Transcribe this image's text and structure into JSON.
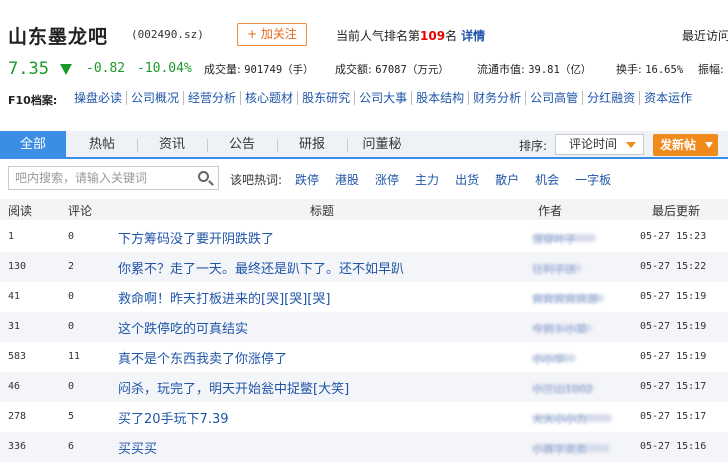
{
  "bar": {
    "name": "山东墨龙吧",
    "code": "(002490.sz)",
    "follow_label": "+ 加关注",
    "rank_prefix": "当前人气排名第",
    "rank_value": "109",
    "rank_suffix": "名",
    "rank_detail": "详情",
    "recent_visit": "最近访问"
  },
  "quote": {
    "price": "7.35",
    "change": "-0.82",
    "change_pct": "-10.04%",
    "direction": "down",
    "color": "#1a9a2a",
    "stats": [
      {
        "label": "成交量:",
        "value": "901749（手）"
      },
      {
        "label": "成交额:",
        "value": "67087（万元）"
      },
      {
        "label": "流通市值:",
        "value": "39.81（亿）"
      },
      {
        "label": "换手:",
        "value": "16.65%"
      },
      {
        "label": "振幅:",
        "value": ""
      }
    ]
  },
  "f10": {
    "label": "F10档案:",
    "links": [
      "操盘必读",
      "公司概况",
      "经营分析",
      "核心题材",
      "股东研究",
      "公司大事",
      "股本结构",
      "财务分析",
      "公司高管",
      "分红融资",
      "资本运作"
    ]
  },
  "tabs": {
    "items": [
      "全部",
      "热帖",
      "资讯",
      "公告",
      "研报",
      "问董秘"
    ],
    "active": 0,
    "sort_label": "排序:",
    "sort_value": "评论时间",
    "post_button": "发新帖"
  },
  "search": {
    "placeholder": "吧内搜索，请输入关键词",
    "hot_label": "该吧热词:",
    "hot_words": [
      "跌停",
      "港股",
      "涨停",
      "主力",
      "出货",
      "散户",
      "机会",
      "一字板"
    ]
  },
  "table": {
    "headers": {
      "read": "阅读",
      "comment": "评论",
      "title": "标题",
      "author": "作者",
      "updated": "最后更新"
    },
    "rows": [
      {
        "read": "1",
        "comment": "0",
        "title": "下方筹码没了要开阴跌跌了",
        "author": "涅穿叶子",
        "time": "05-27 15:23"
      },
      {
        "read": "130",
        "comment": "2",
        "title": "你累不？走了一天。最终还是趴下了。还不如早趴",
        "author": "让利子送",
        "time": "05-27 15:22"
      },
      {
        "read": "41",
        "comment": "0",
        "title": "救命啊！昨天打板进来的[哭][哭][哭]",
        "author": "宾宾宾宾宾源",
        "time": "05-27 15:19"
      },
      {
        "read": "31",
        "comment": "0",
        "title": "这个跌停吃的可真结实",
        "author": "今到卜小菜",
        "time": "05-27 15:19"
      },
      {
        "read": "583",
        "comment": "11",
        "title": "真不是个东西我卖了你涨停了",
        "author": "小小华",
        "time": "05-27 15:19"
      },
      {
        "read": "46",
        "comment": "0",
        "title": "闷杀，玩完了，明天开始瓮中捉鳖[大笑]",
        "author": "小三山1002",
        "time": "05-27 15:17"
      },
      {
        "read": "278",
        "comment": "5",
        "title": "买了20手玩下7.39",
        "author": "大大小小力",
        "time": "05-27 15:17"
      },
      {
        "read": "336",
        "comment": "6",
        "title": "买买买",
        "author": "小赛字卖卖",
        "time": "05-27 15:16"
      }
    ]
  }
}
